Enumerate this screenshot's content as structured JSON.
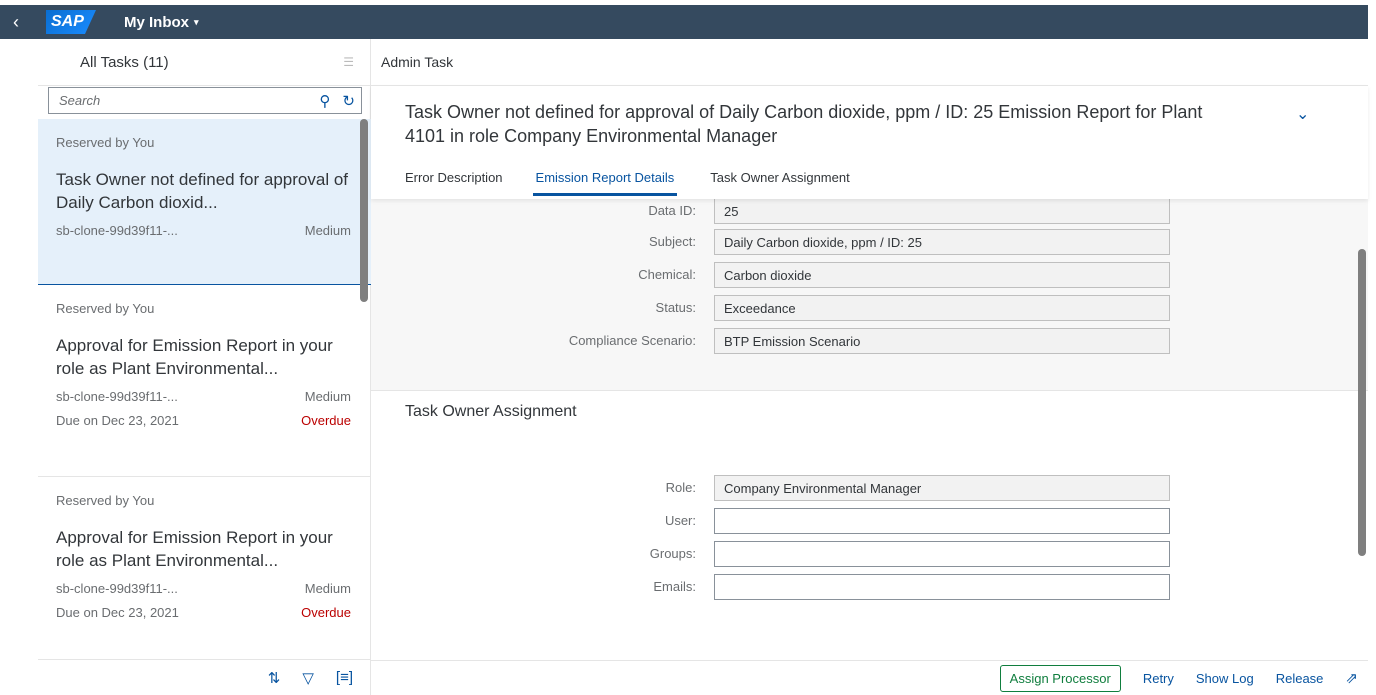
{
  "shell": {
    "back": "‹",
    "logo": "SAP",
    "title": "My Inbox",
    "caret": "▾"
  },
  "master": {
    "title": "All Tasks (11)",
    "select_icon": "☰",
    "search_placeholder": "Search",
    "search_icon": "⚲",
    "refresh_icon": "↻",
    "items": [
      {
        "reserved": "Reserved by You",
        "title": "Task Owner not defined for approval of Daily Carbon dioxid...",
        "source": "sb-clone-99d39f11-...",
        "priority": "Medium",
        "due": "",
        "status": ""
      },
      {
        "reserved": "Reserved by You",
        "title": "Approval for Emission Report in your role as Plant Environmental...",
        "source": "sb-clone-99d39f11-...",
        "priority": "Medium",
        "due": "Due on Dec 23, 2021",
        "status": "Overdue"
      },
      {
        "reserved": "Reserved by You",
        "title": "Approval for Emission Report in your role as Plant Environmental...",
        "source": "sb-clone-99d39f11-...",
        "priority": "Medium",
        "due": "Due on Dec 23, 2021",
        "status": "Overdue"
      }
    ],
    "footer": {
      "sort_icon": "⇅",
      "filter_icon": "▽",
      "group_icon": "[≡]"
    }
  },
  "detail": {
    "topbar": "Admin Task",
    "title": "Task Owner not defined for approval of Daily Carbon dioxide, ppm / ID: 25 Emission Report for Plant 4101 in role Company Environmental Manager",
    "collapse_icon": "⌄",
    "tabs": [
      "Error Description",
      "Emission Report Details",
      "Task Owner Assignment"
    ],
    "report_fields": [
      {
        "label": "Data ID:",
        "value": "25"
      },
      {
        "label": "Subject:",
        "value": "Daily Carbon dioxide, ppm / ID: 25"
      },
      {
        "label": "Chemical:",
        "value": "Carbon dioxide"
      },
      {
        "label": "Status:",
        "value": "Exceedance"
      },
      {
        "label": "Compliance Scenario:",
        "value": "BTP Emission Scenario"
      }
    ],
    "section_title": "Task Owner Assignment",
    "assignment_fields": [
      {
        "label": "Role:",
        "value": "Company Environmental Manager"
      },
      {
        "label": "User:",
        "value": ""
      },
      {
        "label": "Groups:",
        "value": ""
      },
      {
        "label": "Emails:",
        "value": ""
      }
    ],
    "actions": {
      "assign": "Assign Processor",
      "retry": "Retry",
      "log": "Show Log",
      "release": "Release",
      "share_icon": "⇗"
    }
  }
}
